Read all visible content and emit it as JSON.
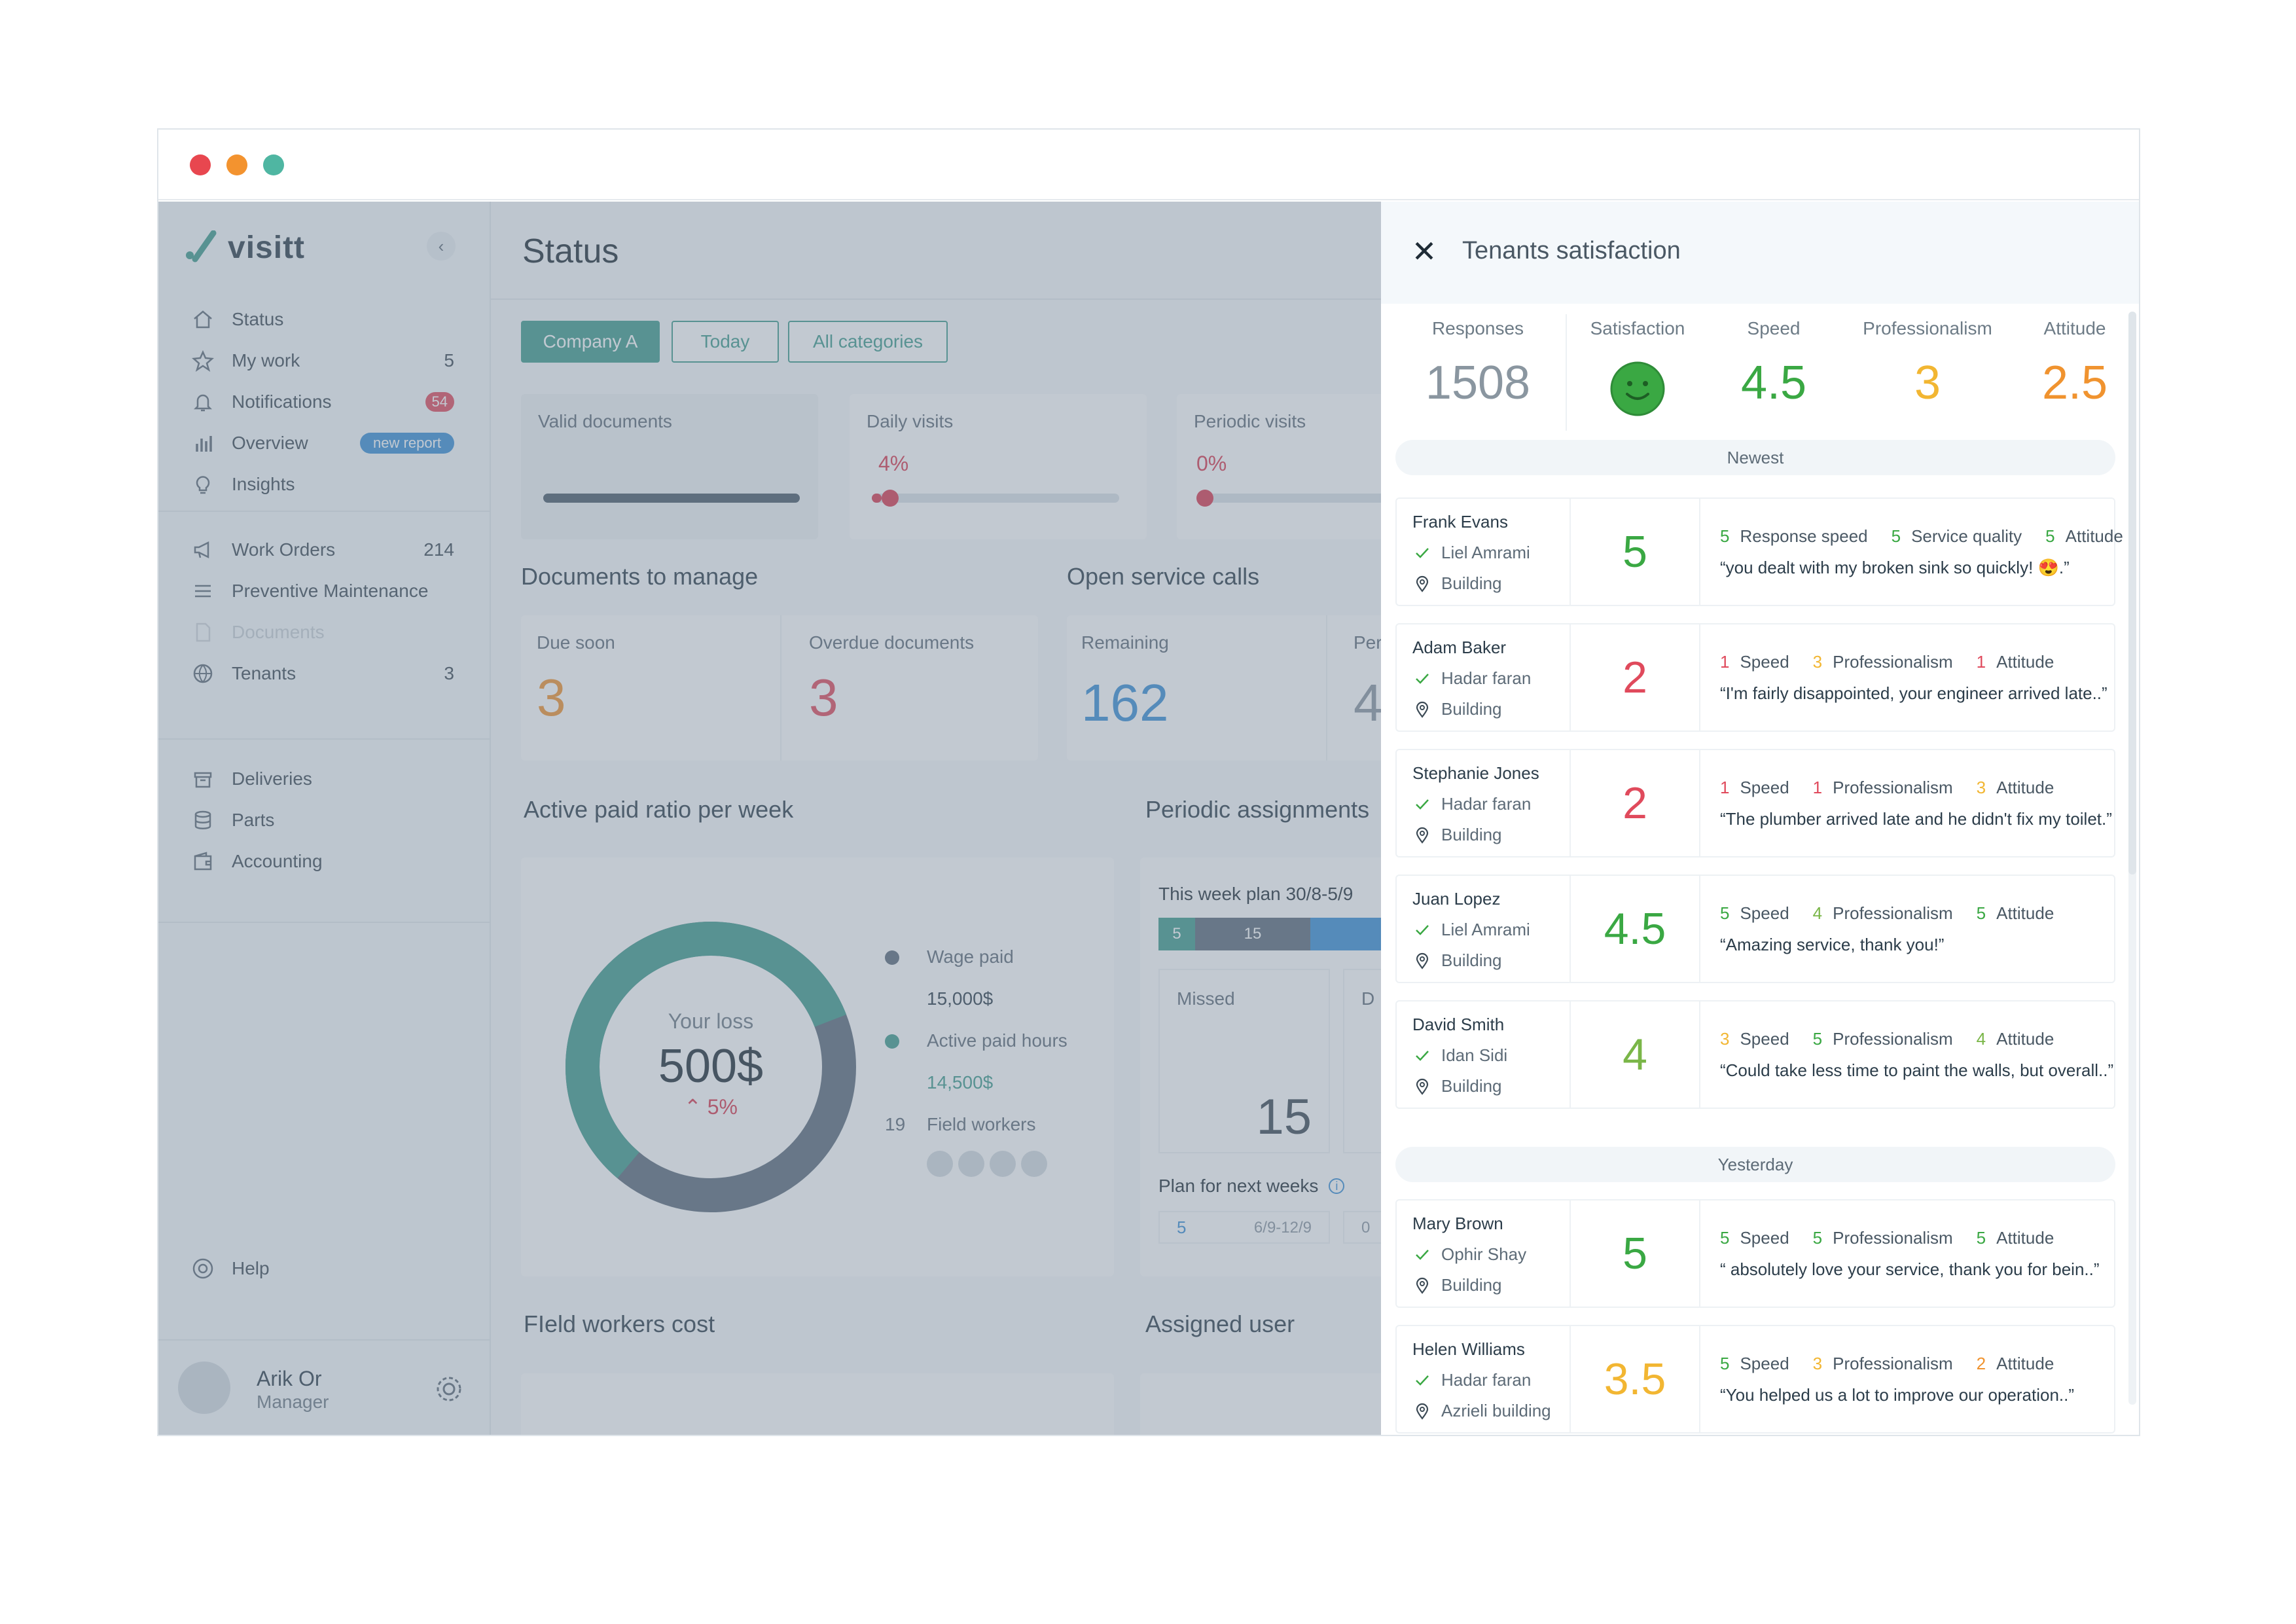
{
  "window": {
    "traffic_lights": [
      "#e8474f",
      "#f3932f",
      "#4fb6a2"
    ]
  },
  "sidebar": {
    "brand": "visitt",
    "collapse_icon": "chevron-left-icon",
    "main_items": [
      {
        "label": "Status",
        "icon": "home-icon"
      },
      {
        "label": "My work",
        "icon": "star-icon",
        "count": "5"
      },
      {
        "label": "Notifications",
        "icon": "bell-icon",
        "badge": "54"
      },
      {
        "label": "Overview",
        "icon": "bar-chart-icon",
        "badge": "new report"
      },
      {
        "label": "Insights",
        "icon": "lightbulb-icon"
      }
    ],
    "work_items": [
      {
        "label": "Work Orders",
        "icon": "megaphone-icon",
        "count": "214"
      },
      {
        "label": "Preventive Maintenance",
        "icon": "list-icon"
      },
      {
        "label": "Documents",
        "icon": "document-icon"
      },
      {
        "label": "Tenants",
        "icon": "globe-icon",
        "count": "3"
      }
    ],
    "extra_items": [
      {
        "label": "Deliveries",
        "icon": "box-icon"
      },
      {
        "label": "Parts",
        "icon": "database-icon"
      },
      {
        "label": "Accounting",
        "icon": "wallet-icon"
      }
    ],
    "help": "Help",
    "user": {
      "name": "Arik Or",
      "role": "Manager"
    }
  },
  "main": {
    "title": "Status",
    "filters": [
      "Company A",
      "Today",
      "All categories"
    ],
    "cards": {
      "valid_documents": "Valid documents",
      "daily_visits": "Daily visits",
      "daily_visits_value": "4%",
      "daily_visits_fraction": 0.04,
      "periodic_visits": "Periodic visits",
      "periodic_visits_value": "0%",
      "periodic_visits_fraction": 0
    },
    "documents_to_manage": {
      "title": "Documents to manage",
      "due_soon_label": "Due soon",
      "due_soon_value": "3",
      "overdue_label": "Overdue documents",
      "overdue_value": "3"
    },
    "open_service_calls": {
      "title": "Open service calls",
      "remaining_label": "Remaining",
      "remaining_value": "162",
      "next_label": "Per",
      "next_value": "4"
    },
    "active_paid": {
      "title": "Active paid ratio per week",
      "center_label": "Your loss",
      "center_value": "500$",
      "change": "5%",
      "legend": [
        {
          "label": "Wage paid",
          "value": "15,000$",
          "color": "#5b6b7a"
        },
        {
          "label": "Active paid hours",
          "value": "14,500$",
          "color": "#3e9b8d"
        }
      ],
      "workers_count": "19",
      "workers_label": "Field workers"
    },
    "periodic_assignments": {
      "title": "Periodic assignments",
      "week_plan": "This week plan 30/8-5/9",
      "bar_values": [
        "5",
        "15"
      ],
      "missed_label": "Missed",
      "missed_value": "15",
      "next_col_label": "D",
      "plan_next": "Plan for next weeks",
      "next_value": "5",
      "next_range": "6/9-12/9",
      "next_extra": "0"
    },
    "field_workers_cost": "FIeld workers cost",
    "assigned_user": "Assigned user"
  },
  "panel": {
    "title": "Tenants satisfaction",
    "close_icon": "close-icon",
    "stats": [
      {
        "label": "Responses",
        "value": "1508",
        "color": "#8a96a0"
      },
      {
        "label": "Satisfaction",
        "value": "",
        "color": "#3aa843"
      },
      {
        "label": "Speed",
        "value": "4.5",
        "color": "#3aa843"
      },
      {
        "label": "Professionalism",
        "value": "3",
        "color": "#f2b632"
      },
      {
        "label": "Attitude",
        "value": "2.5",
        "color": "#f0932f"
      }
    ],
    "groups": [
      "Newest",
      "Yesterday"
    ],
    "responses": [
      {
        "name": "Frank Evans",
        "engineer": "Liel Amrami",
        "building": "Building",
        "score": "5",
        "score_color": "#3aa843",
        "metrics": [
          {
            "n": "5",
            "label": "Response speed",
            "c": "#3aa843"
          },
          {
            "n": "5",
            "label": "Service quality",
            "c": "#3aa843"
          },
          {
            "n": "5",
            "label": "Attitude",
            "c": "#3aa843"
          }
        ],
        "quote": "“you dealt with my broken sink so quickly! 😍.”"
      },
      {
        "name": "Adam Baker",
        "engineer": "Hadar faran",
        "building": "Building",
        "score": "2",
        "score_color": "#e04a5c",
        "metrics": [
          {
            "n": "1",
            "label": "Speed",
            "c": "#e04a5c"
          },
          {
            "n": "3",
            "label": "Professionalism",
            "c": "#f2b632"
          },
          {
            "n": "1",
            "label": "Attitude",
            "c": "#e04a5c"
          }
        ],
        "quote": "“I'm fairly disappointed, your engineer arrived late..”"
      },
      {
        "name": "Stephanie Jones",
        "engineer": "Hadar faran",
        "building": "Building",
        "score": "2",
        "score_color": "#e04a5c",
        "metrics": [
          {
            "n": "1",
            "label": "Speed",
            "c": "#e04a5c"
          },
          {
            "n": "1",
            "label": "Professionalism",
            "c": "#e04a5c"
          },
          {
            "n": "3",
            "label": "Attitude",
            "c": "#f2b632"
          }
        ],
        "quote": "“The plumber arrived late and he didn't fix my toilet.”"
      },
      {
        "name": "Juan Lopez",
        "engineer": "Liel Amrami",
        "building": "Building",
        "score": "4.5",
        "score_color": "#3aa843",
        "metrics": [
          {
            "n": "5",
            "label": "Speed",
            "c": "#3aa843"
          },
          {
            "n": "4",
            "label": "Professionalism",
            "c": "#7ab648"
          },
          {
            "n": "5",
            "label": "Attitude",
            "c": "#3aa843"
          }
        ],
        "quote": "“Amazing service, thank you!”"
      },
      {
        "name": "David Smith",
        "engineer": "Idan Sidi",
        "building": "Building",
        "score": "4",
        "score_color": "#7ab648",
        "metrics": [
          {
            "n": "3",
            "label": "Speed",
            "c": "#f2b632"
          },
          {
            "n": "5",
            "label": "Professionalism",
            "c": "#3aa843"
          },
          {
            "n": "4",
            "label": "Attitude",
            "c": "#7ab648"
          }
        ],
        "quote": "“Could take less time to paint the walls, but overall..”"
      },
      {
        "name": "Mary Brown",
        "engineer": "Ophir Shay",
        "building": "Building",
        "score": "5",
        "score_color": "#3aa843",
        "metrics": [
          {
            "n": "5",
            "label": "Speed",
            "c": "#3aa843"
          },
          {
            "n": "5",
            "label": "Professionalism",
            "c": "#3aa843"
          },
          {
            "n": "5",
            "label": "Attitude",
            "c": "#3aa843"
          }
        ],
        "quote": "“ absolutely love your service, thank you for bein..”"
      },
      {
        "name": "Helen Williams",
        "engineer": "Hadar faran",
        "building": "Azrieli building",
        "score": "3.5",
        "score_color": "#f2b632",
        "metrics": [
          {
            "n": "5",
            "label": "Speed",
            "c": "#3aa843"
          },
          {
            "n": "3",
            "label": "Professionalism",
            "c": "#f2b632"
          },
          {
            "n": "2",
            "label": "Attitude",
            "c": "#f0932f"
          }
        ],
        "quote": "“You helped us a lot to improve our operation..”"
      },
      {
        "name": "Helen Williams",
        "engineer": "",
        "building": "",
        "score": "",
        "score_color": "#3aa843",
        "metrics": [],
        "quote": ""
      }
    ]
  }
}
